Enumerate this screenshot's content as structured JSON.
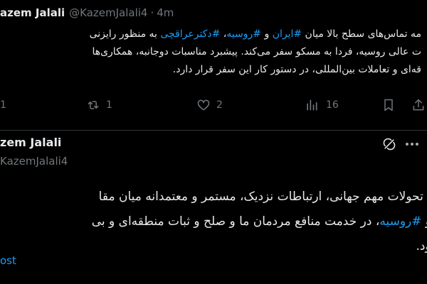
{
  "tweet1": {
    "display_name": "azem Jalali",
    "handle": "@KazemJalali4",
    "separator": "·",
    "time": "4m",
    "body": {
      "l1": {
        "a": "مه تماس‌های سطح بالا میان ",
        "b": "#ایران",
        "c": " و ",
        "d": "#روسیه",
        "e": "، ",
        "f": "#دکترعراقچی",
        "g": " به منظور رایزنی"
      },
      "l2": "ت عالی روسیه، فردا به مسکو سفر می‌کند. پیشبرد مناسبات دوجانبه، همکاری‌ها",
      "l3": "قه‌ای و تعاملات بین‌المللی، در دستور کار این سفر قرار دارد."
    },
    "actions": {
      "reply_count": "1",
      "retweet_count": "1",
      "like_count": "2",
      "view_count": "16"
    }
  },
  "tweet2": {
    "display_name": "zem Jalali",
    "handle": "KazemJalali4",
    "body": {
      "l1": "یانه تحولات مهم جهانی، ارتباطات نزدیک، مستمر و معتمدانه میان مقا",
      "l2": {
        "a": "ن",
        "b": " و ",
        "c": "#روسیه",
        "d": "، در خدمت منافع مردمان ما و صلح و ثبات منطقه‌ای و بی"
      },
      "l3": "د بود."
    },
    "footer_link": "ost"
  },
  "colors": {
    "background": "#000000",
    "text": "#e7e9ea",
    "muted": "#71767b",
    "accent": "#1d9bf0",
    "divider": "#2f3336"
  },
  "icons": [
    "reply-icon",
    "retweet-icon",
    "like-icon",
    "views-icon",
    "bookmark-icon",
    "share-icon",
    "grok-icon",
    "more-icon"
  ]
}
